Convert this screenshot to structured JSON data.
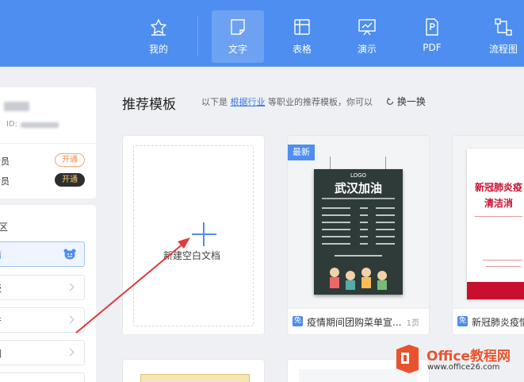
{
  "topnav": {
    "items": [
      {
        "label": "我的",
        "icon": "star-icon"
      },
      {
        "label": "文字",
        "icon": "doc-icon"
      },
      {
        "label": "表格",
        "icon": "table-icon"
      },
      {
        "label": "演示",
        "icon": "presentation-icon"
      },
      {
        "label": "PDF",
        "icon": "pdf-icon"
      },
      {
        "label": "流程图",
        "icon": "flowchart-icon"
      }
    ],
    "active": "文字",
    "accent": "#4d8ef0"
  },
  "user": {
    "id_label": "ID:",
    "rows": [
      {
        "label": "会员",
        "button": "开通",
        "style": "outline"
      },
      {
        "label": "会员",
        "button": "开通",
        "style": "dark"
      }
    ]
  },
  "sidebar": {
    "section": "区",
    "items": [
      {
        "label": "情",
        "active": true
      },
      {
        "label": "板"
      },
      {
        "label": "产"
      },
      {
        "label": "刷"
      }
    ]
  },
  "main": {
    "title": "推荐模板",
    "desc_prefix": "以下是",
    "desc_link": "根据行业",
    "desc_suffix": "等职业的推荐模板，你可以",
    "refresh": "换一换",
    "new_doc": "新建空白文档",
    "templates": [
      {
        "badge": "最新",
        "free": "免",
        "name": "疫情期间团购菜单宣...",
        "pages": "1页",
        "poster_logo": "LOGO",
        "poster_title": "武汉加油"
      },
      {
        "free": "免",
        "name": "新冠肺炎疫情",
        "poster_line1": "新冠肺炎疫",
        "poster_line2": "清洁消"
      }
    ]
  },
  "watermark": {
    "title": "Office教程网",
    "url": "www.office26.com"
  }
}
